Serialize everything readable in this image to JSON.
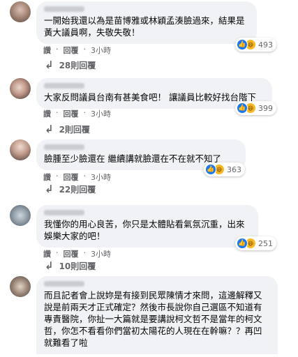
{
  "comments": [
    {
      "text": "一開始我還以為是苗博雅或林穎孟湊臉過來，結果是黃大議員啊，失敬失敬！",
      "reaction_count": "493",
      "like_label": "讚",
      "reply_label": "回覆",
      "time": "3小時",
      "replies_label": "28則回覆"
    },
    {
      "text": "大家反問議員台南有甚美食吧！ 讓議員比較好找台階下",
      "reaction_count": "399",
      "like_label": "讚",
      "reply_label": "回覆",
      "time": "3小時",
      "replies_label": "2則回覆"
    },
    {
      "text": "臉腫至少臉還在 繼續講就臉還在不在就不知了",
      "reaction_count": "363",
      "like_label": "讚",
      "reply_label": "回覆",
      "time": "3小時",
      "replies_label": "22則回覆"
    },
    {
      "text": "我懂你的用心良苦，你只是太體貼看氣氛沉重，出來娛樂大家的吧！",
      "reaction_count": "251",
      "like_label": "讚",
      "reply_label": "回覆",
      "time": "3小時",
      "replies_label": "10則回覆"
    },
    {
      "text": "而且記者會上說妳是有接到民眾陳情才來問，這邊解釋又說是前兩天才正式確定？然後市長說你自己選區不知道有專責醫院，你扯一大篇就是要講說柯文哲不是當年的柯文哲，你怎不看看你們當初太陽花的人現在在幹嘛？？再凹就難看了啦"
    }
  ],
  "colors": {
    "bubble_bg": "#f0f2f5",
    "like_blue": "#1877f2",
    "haha_yellow": "#f7b928",
    "meta_gray": "#65676b"
  },
  "icons": [
    "like-icon",
    "haha-icon",
    "reply-arrow-icon"
  ]
}
